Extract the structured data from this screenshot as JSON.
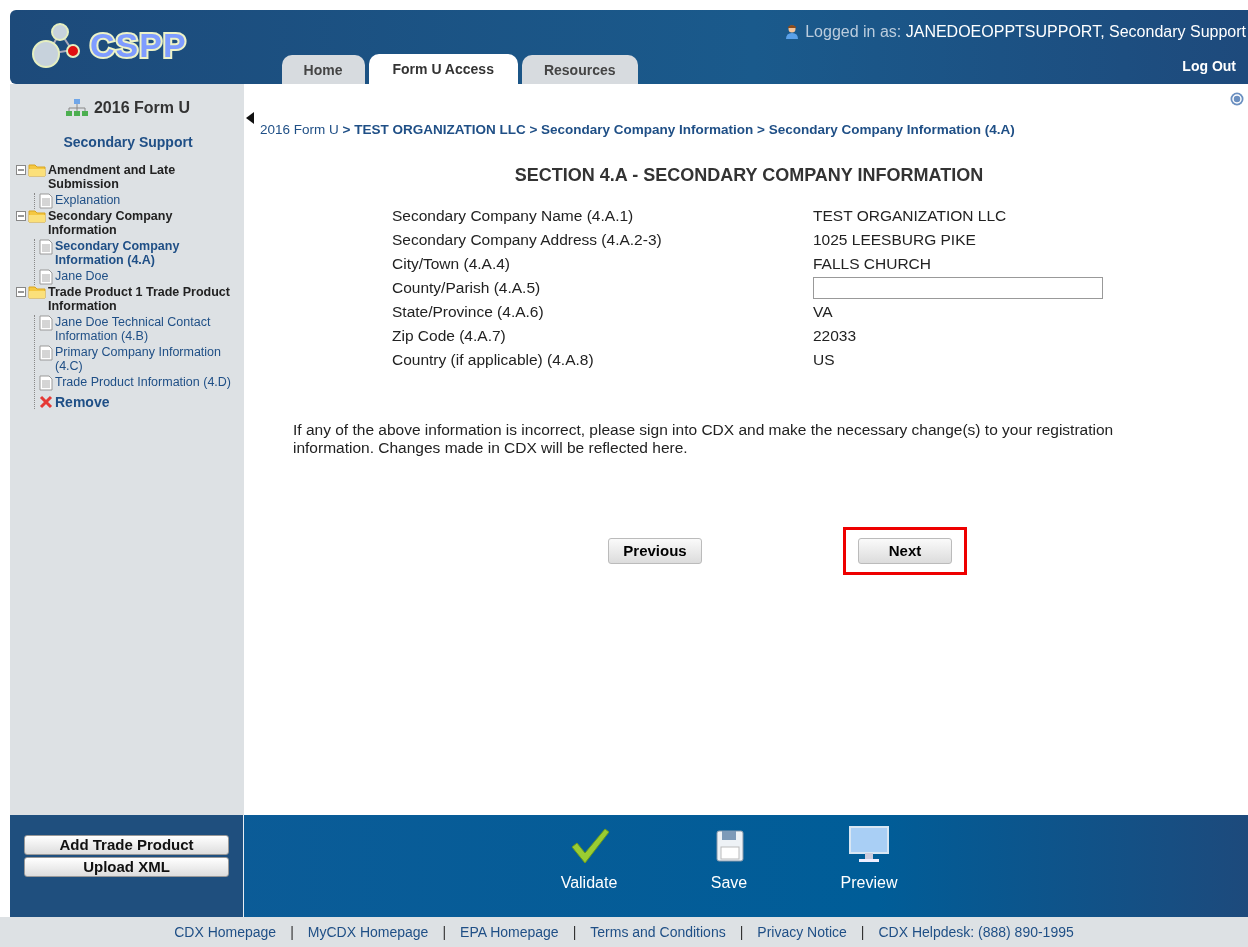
{
  "header": {
    "app_name": "CSPP",
    "logged_in_label": "Logged in as:",
    "logged_in_user": "JANEDOEOPPTSUPPORT, Secondary Support",
    "logout": "Log Out"
  },
  "tabs": [
    {
      "label": "Home",
      "selected": false
    },
    {
      "label": "Form U Access",
      "selected": true
    },
    {
      "label": "Resources",
      "selected": false
    }
  ],
  "sidebar": {
    "title": "2016 Form U",
    "subtitle": "Secondary Support",
    "tree": [
      {
        "kind": "folder",
        "label": "Amendment and Late Submission",
        "expanded": true,
        "children": [
          {
            "kind": "page",
            "label": "Explanation",
            "selected": false
          }
        ]
      },
      {
        "kind": "folder",
        "label": "Secondary Company Information",
        "expanded": true,
        "children": [
          {
            "kind": "page",
            "label": "Secondary Company Information (4.A)",
            "selected": true
          },
          {
            "kind": "page",
            "label": "Jane Doe",
            "selected": false
          }
        ]
      },
      {
        "kind": "folder",
        "label": "Trade Product 1 Trade Product Information",
        "expanded": true,
        "children": [
          {
            "kind": "page",
            "label": "Jane Doe Technical Contact Information (4.B)",
            "selected": false
          },
          {
            "kind": "page",
            "label": "Primary Company Information (4.C)",
            "selected": false
          },
          {
            "kind": "page",
            "label": "Trade Product Information (4.D)",
            "selected": false
          },
          {
            "kind": "remove",
            "label": "Remove"
          }
        ]
      }
    ],
    "buttons": [
      "Add Trade Product",
      "Upload XML"
    ]
  },
  "breadcrumb": {
    "separator": ">",
    "items": [
      "2016 Form U",
      "TEST ORGANIZATION LLC",
      "Secondary Company Information",
      "Secondary Company Information (4.A)"
    ]
  },
  "section_title": "SECTION 4.A - SECONDARY COMPANY INFORMATION",
  "fields": [
    {
      "kind": "text",
      "label": "Secondary Company Name (4.A.1)",
      "value": "TEST ORGANIZATION LLC"
    },
    {
      "kind": "text",
      "label": "Secondary Company Address (4.A.2-3)",
      "value": "1025 LEESBURG PIKE"
    },
    {
      "kind": "text",
      "label": "City/Town (4.A.4)",
      "value": "FALLS CHURCH"
    },
    {
      "kind": "input",
      "label": "County/Parish (4.A.5)"
    },
    {
      "kind": "text",
      "label": "State/Province (4.A.6)",
      "value": "VA"
    },
    {
      "kind": "text",
      "label": "Zip Code (4.A.7)",
      "value": "22033"
    },
    {
      "kind": "text",
      "label": "Country (if applicable) (4.A.8)",
      "value": "US"
    }
  ],
  "notice": "If any of the above information is incorrect, please sign into CDX and make the necessary change(s) to your registration information. Changes made in CDX will be reflected here.",
  "nav_buttons": [
    {
      "label": "Previous",
      "highlighted": false
    },
    {
      "label": "Next",
      "highlighted": true
    }
  ],
  "toolbar": [
    {
      "kind": "validate",
      "label": "Validate"
    },
    {
      "kind": "save",
      "label": "Save"
    },
    {
      "kind": "preview",
      "label": "Preview"
    }
  ],
  "footer": {
    "separator": "|",
    "links": [
      "CDX Homepage",
      "MyCDX Homepage",
      "EPA Homepage",
      "Terms and Conditions",
      "Privacy Notice",
      "CDX Helpdesk: (888) 890-1995"
    ]
  }
}
